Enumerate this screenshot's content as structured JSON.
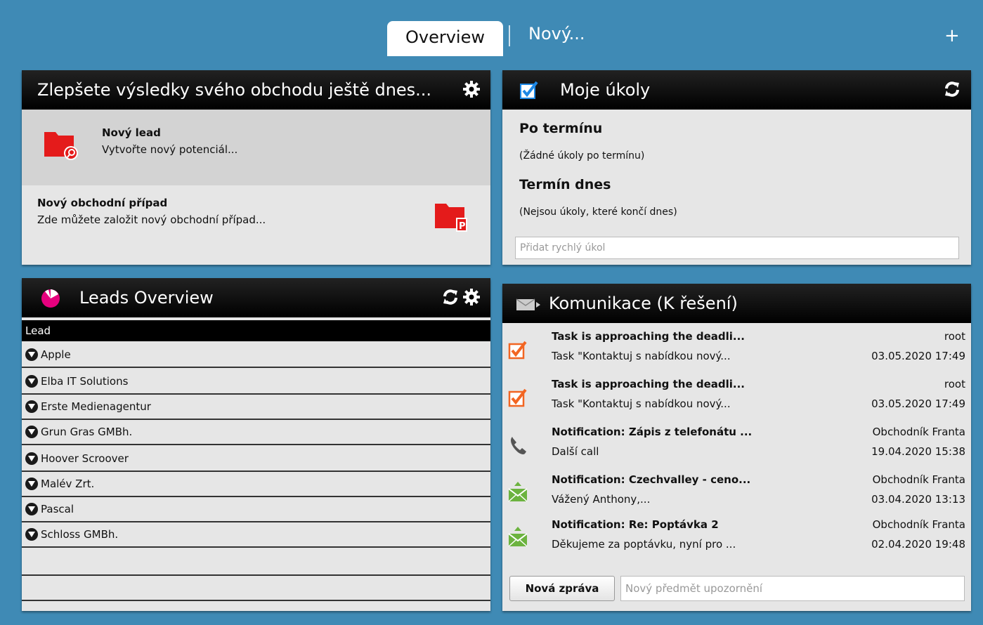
{
  "tabs": {
    "active": "Overview",
    "new": "Nový...",
    "add": "+"
  },
  "panel_actions": {
    "title": "Zlepšete výsledky svého obchodu ještě dnes...",
    "items": [
      {
        "title": "Nový lead",
        "desc": "Vytvořte nový potenciál..."
      },
      {
        "title": "Nový obchodní případ",
        "desc": "Zde můžete založit nový obchodní případ..."
      }
    ]
  },
  "panel_tasks": {
    "title": "Moje úkoly",
    "overdue_title": "Po termínu",
    "overdue_text": "(Žádné úkoly po termínu)",
    "today_title": "Termín dnes",
    "today_text": "(Nejsou úkoly, které končí dnes)",
    "quick_placeholder": "Přidat rychlý úkol"
  },
  "panel_leads": {
    "title": "Leads Overview",
    "column": "Lead",
    "rows": [
      "Apple",
      "Elba IT Solutions",
      "Erste Medienagentur",
      "Grun Gras GMBh.",
      "Hoover Scroover",
      "Malév Zrt.",
      "Pascal",
      "Schloss GMBh."
    ]
  },
  "panel_comm": {
    "title": "Komunikace (K řešení)",
    "messages": [
      {
        "icon": "task-icon",
        "subject": "Task is approaching the deadli...",
        "preview": "Task \"Kontaktuj s nabídkou nový...",
        "user": "root",
        "date": "03.05.2020 17:49"
      },
      {
        "icon": "task-icon",
        "subject": "Task is approaching the deadli...",
        "preview": "Task \"Kontaktuj s nabídkou nový...",
        "user": "root",
        "date": "03.05.2020 17:49"
      },
      {
        "icon": "phone-icon",
        "subject": "Notification: Zápis z telefonátu ...",
        "preview": "Další call",
        "user": "Obchodník Franta",
        "date": "19.04.2020 15:38"
      },
      {
        "icon": "mail-icon",
        "subject": "Notification: Czechvalley - ceno...",
        "preview": "Vážený Anthony,...",
        "user": "Obchodník Franta",
        "date": "03.04.2020 13:13"
      },
      {
        "icon": "mail-icon",
        "subject": "Notification: Re: Poptávka 2",
        "preview": "Děkujeme za poptávku, nyní pro ...",
        "user": "Obchodník Franta",
        "date": "02.04.2020 19:48"
      }
    ],
    "new_button": "Nová zpráva",
    "subject_placeholder": "Nový předmět upozornění"
  },
  "colors": {
    "background": "#3f8ab5",
    "accent_red": "#e41b1b",
    "task_orange": "#f26522",
    "mail_green": "#6cb33f",
    "pie_pink": "#e6007e",
    "checkbox_blue": "#1e88e5"
  }
}
